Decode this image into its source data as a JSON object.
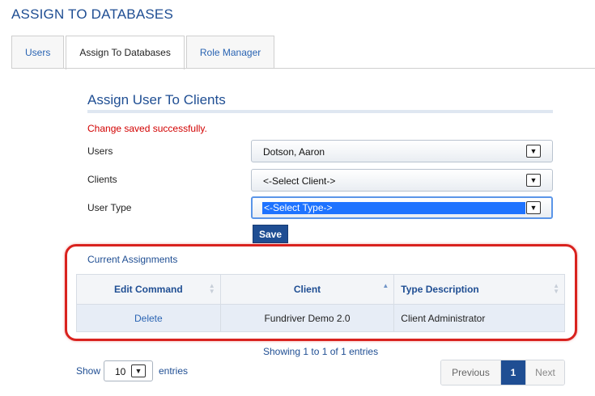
{
  "page": {
    "title": "ASSIGN TO DATABASES"
  },
  "tabs": [
    {
      "label": "Users"
    },
    {
      "label": "Assign To Databases",
      "active": true
    },
    {
      "label": "Role Manager"
    }
  ],
  "form": {
    "section_title": "Assign User To Clients",
    "success_message": "Change saved successfully.",
    "users_label": "Users",
    "users_value": "Dotson, Aaron",
    "clients_label": "Clients",
    "clients_value": "<-Select Client->",
    "user_type_label": "User Type",
    "user_type_value": "<-Select Type->",
    "save_label": "Save"
  },
  "assignments": {
    "title": "Current Assignments",
    "columns": [
      "Edit Command",
      "Client",
      "Type Description"
    ],
    "rows": [
      {
        "edit": "Delete",
        "client": "Fundriver Demo 2.0",
        "type": "Client Administrator"
      }
    ],
    "showing": "Showing 1 to 1 of 1 entries"
  },
  "length": {
    "show_label": "Show",
    "value": "10",
    "entries_label": "entries"
  },
  "pagination": {
    "previous": "Previous",
    "current": "1",
    "next": "Next"
  },
  "icons": {
    "dropdown": "chevron-down-icon",
    "sort": "sort-arrows-icon"
  },
  "colors": {
    "brand": "#1f4e93",
    "success_text": "#d20000",
    "highlight": "#d9221e"
  }
}
